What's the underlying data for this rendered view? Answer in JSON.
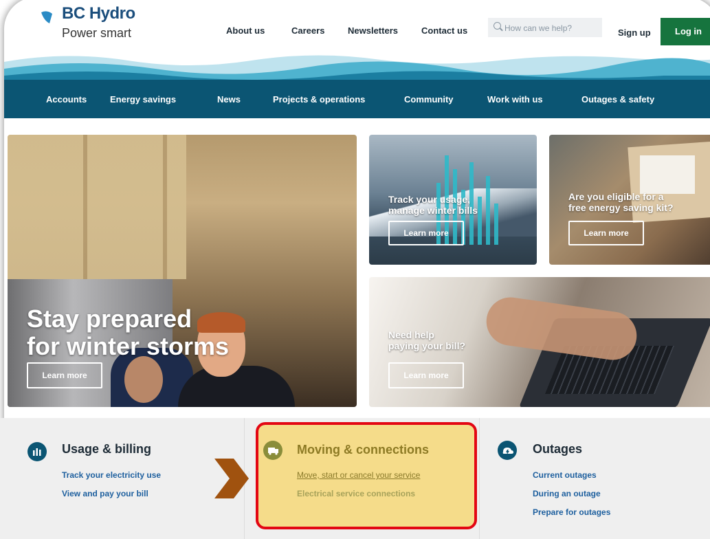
{
  "header": {
    "logo_title": "BC Hydro",
    "logo_subtitle": "Power smart",
    "top_links": [
      "About us",
      "Careers",
      "Newsletters",
      "Contact us"
    ],
    "search_placeholder": "How can we help?",
    "signup_label": "Sign up",
    "login_label": "Log in"
  },
  "nav": {
    "items": [
      "Accounts",
      "Energy savings",
      "News",
      "Projects & operations",
      "Community",
      "Work with us",
      "Outages & safety"
    ]
  },
  "hero": {
    "main_title_line1": "Stay prepared",
    "main_title_line2": "for winter storms",
    "main_cta": "Learn more",
    "usage_title_line1": "Track your usage,",
    "usage_title_line2": "manage winter bills",
    "usage_cta": "Learn more",
    "kit_title_line1": "Are you eligible for a",
    "kit_title_line2": "free energy saving kit?",
    "kit_cta": "Learn more",
    "bill_title_line1": "Need help",
    "bill_title_line2": "paying your bill?",
    "bill_cta": "Learn more"
  },
  "sections": {
    "usage_billing": {
      "title": "Usage & billing",
      "links": [
        "Track your electricity use",
        "View and pay your bill"
      ]
    },
    "moving": {
      "title": "Moving & connections",
      "links": [
        "Move, start or cancel your service",
        "Electrical service connections"
      ]
    },
    "outages": {
      "title": "Outages",
      "links": [
        "Current outages",
        "During an outage",
        "Prepare for outages"
      ]
    }
  },
  "colors": {
    "brand_blue": "#1b4e7c",
    "nav_bg": "#0b5573",
    "login_green": "#16743e",
    "highlight_fill": "#f5dc8a",
    "highlight_border": "#e30613",
    "arrow_brown": "#a0520f"
  },
  "icons": [
    "search-icon",
    "logo-wave-icon",
    "bar-chart-icon",
    "moving-truck-icon",
    "outage-cloud-icon",
    "chevron-right-icon"
  ]
}
